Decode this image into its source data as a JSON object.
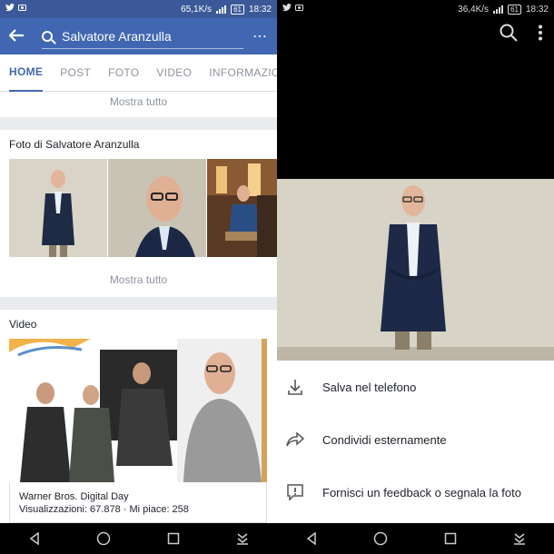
{
  "left": {
    "status": {
      "speed": "65,1K/s",
      "battery": "61",
      "time": "18:32"
    },
    "header": {
      "search_text": "Salvatore Aranzulla",
      "more_label": "⋯"
    },
    "tabs": [
      "HOME",
      "POST",
      "FOTO",
      "VIDEO",
      "INFORMAZIONI"
    ],
    "show_all_top": "Mostra tutto",
    "photos_section": {
      "title": "Foto di Salvatore Aranzulla",
      "show_all": "Mostra tutto"
    },
    "video_section": {
      "title": "Video",
      "video_title": "Warner Bros. Digital Day",
      "video_stats": "Visualizzazioni: 67.878 · Mi piace: 258"
    }
  },
  "right": {
    "status": {
      "speed": "36,4K/s",
      "battery": "61",
      "time": "18:32"
    },
    "menu": [
      {
        "label": "Salva nel telefono",
        "icon": "download-icon"
      },
      {
        "label": "Condividi esternamente",
        "icon": "share-icon"
      },
      {
        "label": "Fornisci un feedback o segnala la foto",
        "icon": "report-icon"
      }
    ]
  },
  "colors": {
    "fb_blue": "#4267b2",
    "header_dark": "#3b5998"
  }
}
